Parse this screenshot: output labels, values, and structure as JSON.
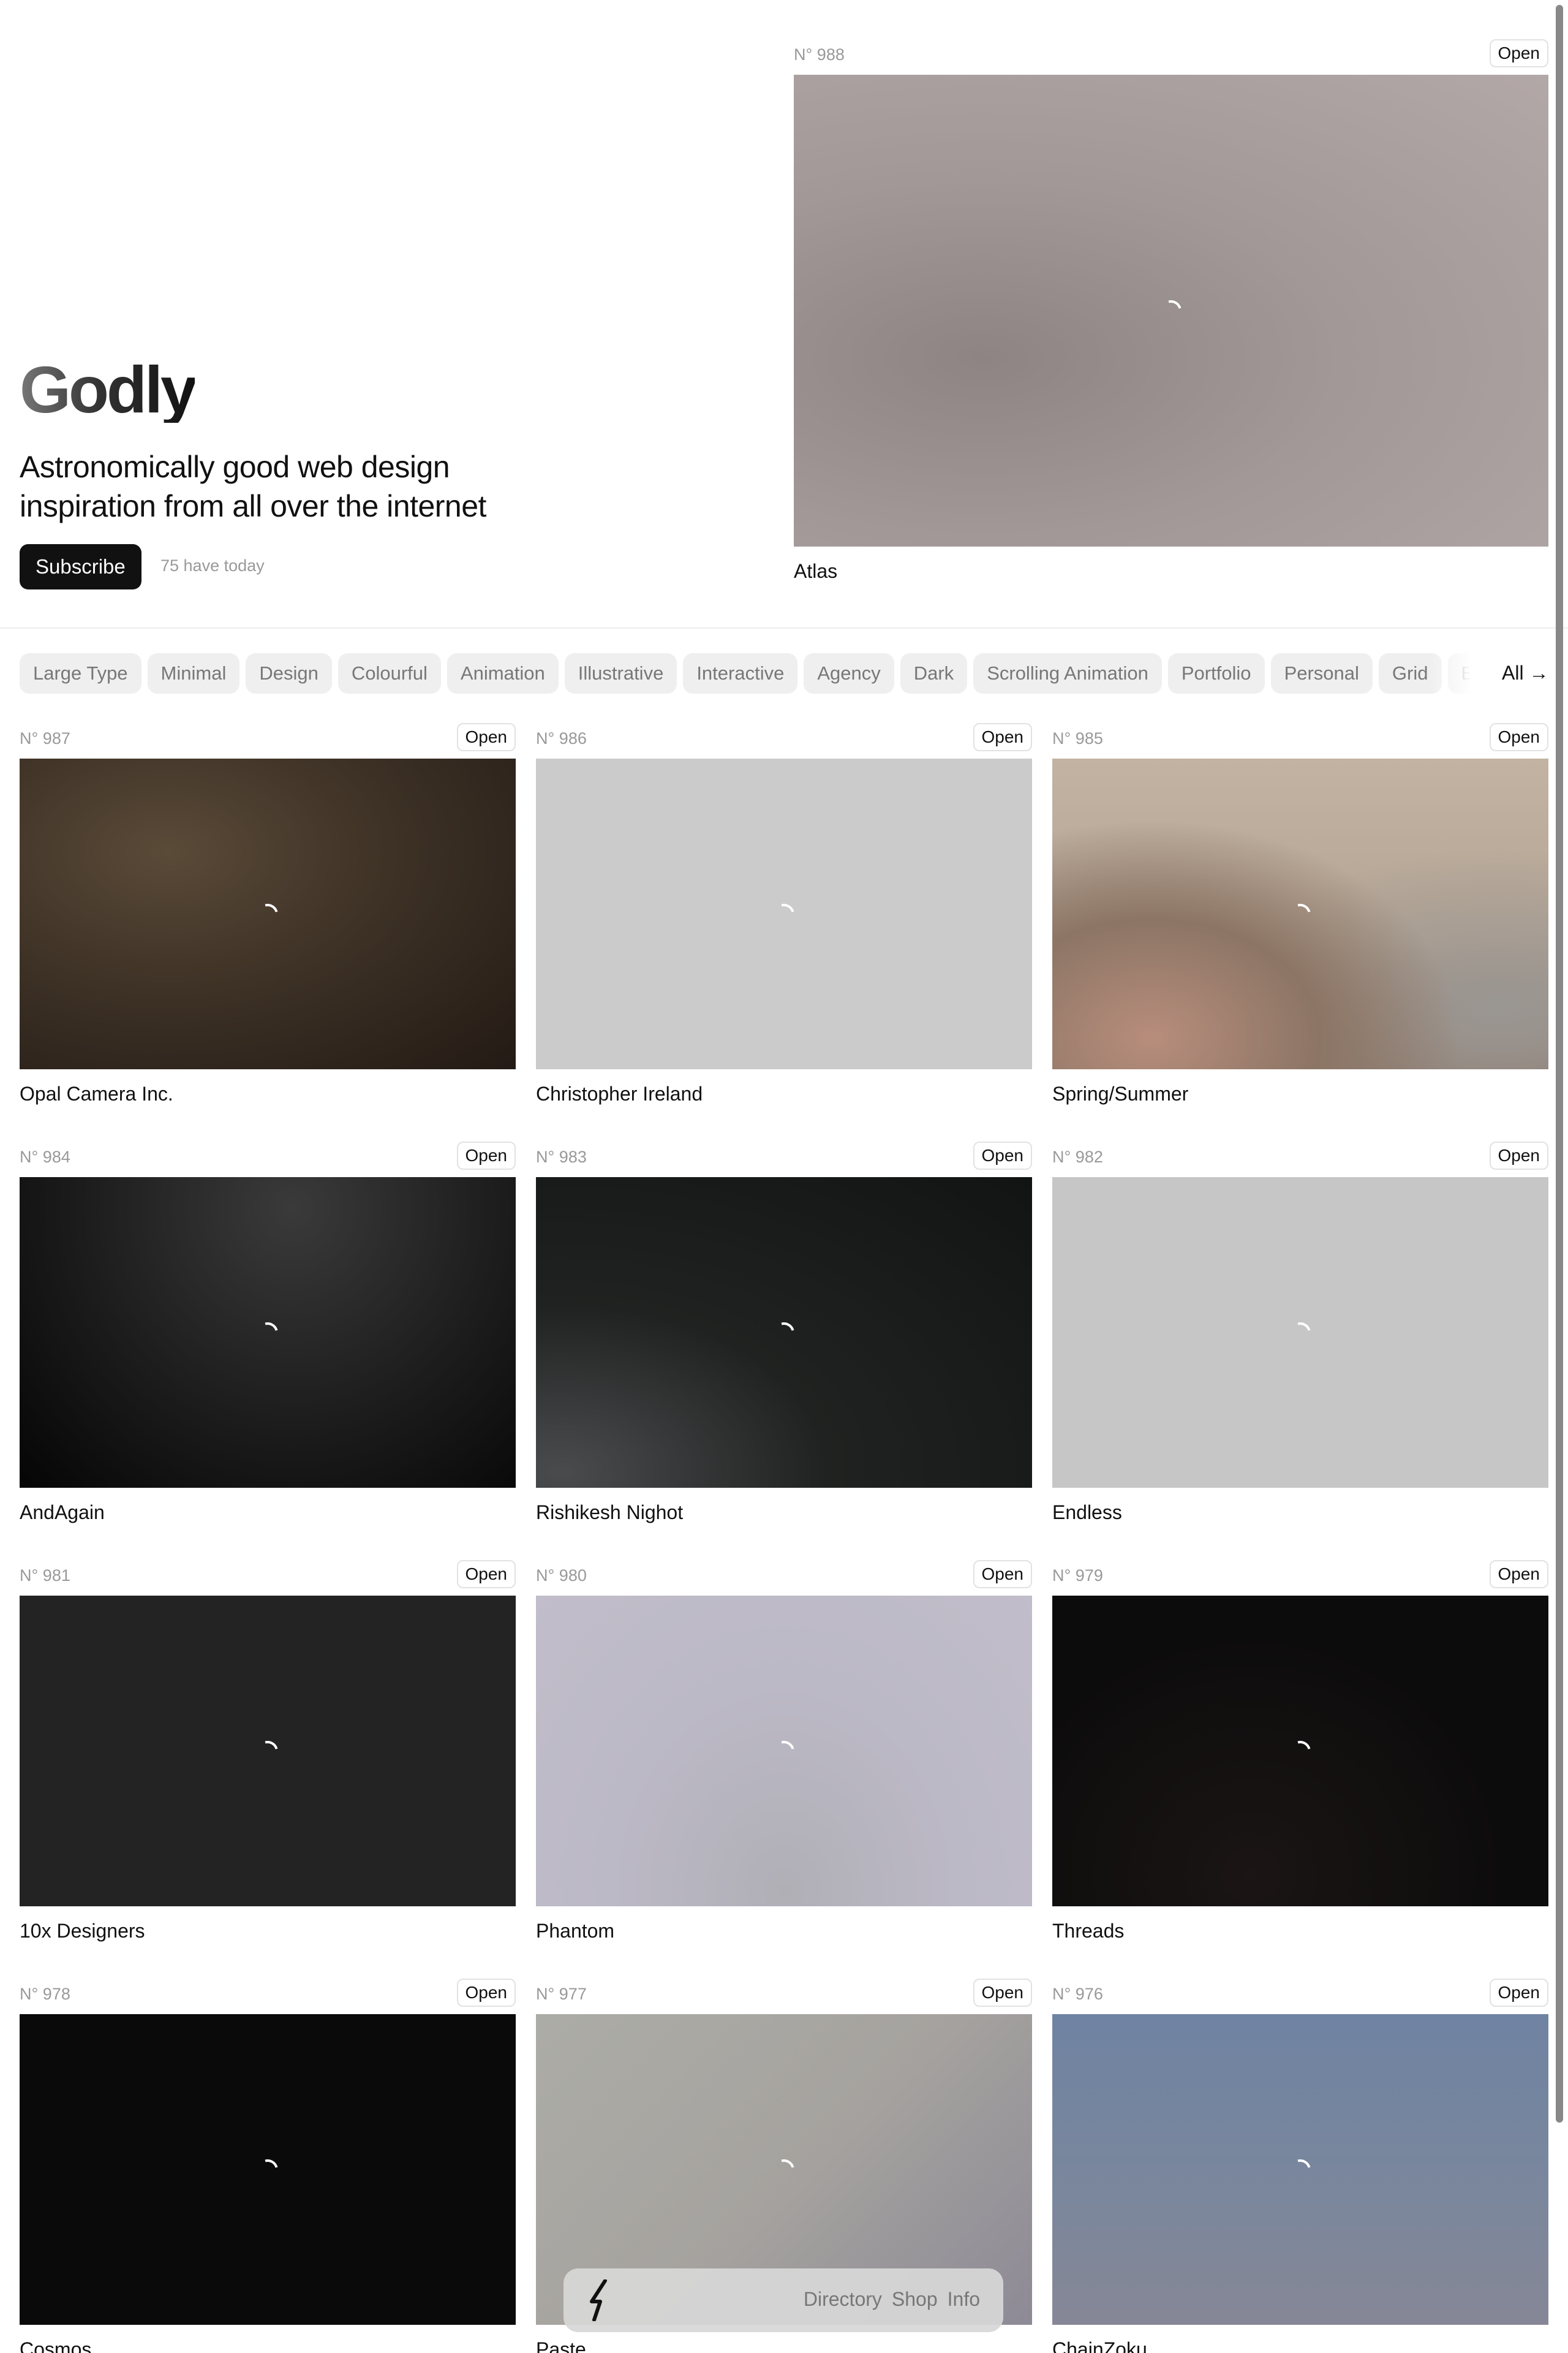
{
  "hero": {
    "brand": "Godly",
    "tagline": "Astronomically good web design inspiration from all over the internet",
    "subscribe_label": "Subscribe",
    "subscribers_today": "75 have today",
    "featured": {
      "number": "N° 988",
      "open_label": "Open",
      "title": "Atlas"
    }
  },
  "filters": {
    "chips": [
      "Large Type",
      "Minimal",
      "Design",
      "Colourful",
      "Animation",
      "Illustrative",
      "Interactive",
      "Agency",
      "Dark",
      "Scrolling Animation",
      "Portfolio",
      "Personal",
      "Grid",
      "E"
    ],
    "all_label": "All →"
  },
  "cards": [
    {
      "number": "N° 987",
      "open_label": "Open",
      "title": "Opal Camera Inc."
    },
    {
      "number": "N° 986",
      "open_label": "Open",
      "title": "Christopher Ireland"
    },
    {
      "number": "N° 985",
      "open_label": "Open",
      "title": "Spring/Summer"
    },
    {
      "number": "N° 984",
      "open_label": "Open",
      "title": "AndAgain"
    },
    {
      "number": "N° 983",
      "open_label": "Open",
      "title": "Rishikesh Nighot"
    },
    {
      "number": "N° 982",
      "open_label": "Open",
      "title": "Endless"
    },
    {
      "number": "N° 981",
      "open_label": "Open",
      "title": "10x Designers"
    },
    {
      "number": "N° 980",
      "open_label": "Open",
      "title": "Phantom"
    },
    {
      "number": "N° 979",
      "open_label": "Open",
      "title": "Threads"
    },
    {
      "number": "N° 978",
      "open_label": "Open",
      "title": "Cosmos"
    },
    {
      "number": "N° 977",
      "open_label": "Open",
      "title": "Paste"
    },
    {
      "number": "N° 976",
      "open_label": "Open",
      "title": "ChainZoku"
    }
  ],
  "bottom_nav": {
    "logo_icon": "lightning-bolt-icon",
    "links": [
      "Directory",
      "Shop",
      "Info"
    ]
  }
}
